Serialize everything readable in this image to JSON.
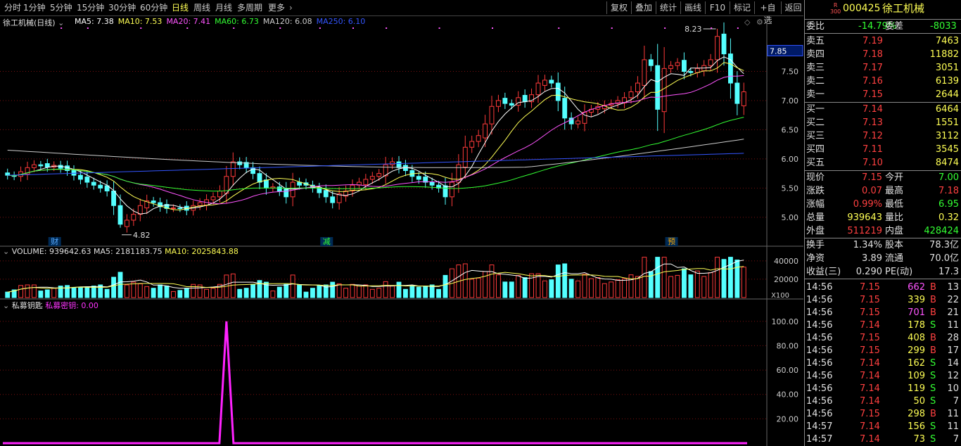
{
  "toolbar": {
    "tabs": [
      "分时",
      "1分钟",
      "5分钟",
      "15分钟",
      "30分钟",
      "60分钟",
      "日线",
      "周线",
      "月线",
      "多周期",
      "更多"
    ],
    "active_tab": "日线",
    "more_arrow": "›",
    "right_buttons": [
      "复权",
      "叠加",
      "统计",
      "画线",
      "F10",
      "标记",
      "+自选",
      "返回"
    ]
  },
  "stock": {
    "code": "000425",
    "name": "徐工机械",
    "badge_top": "R",
    "badge_bottom": "300"
  },
  "kline_header": {
    "title": "徐工机械(日线)",
    "ma": [
      {
        "label": "MA5: 7.38",
        "color": "#ffffff"
      },
      {
        "label": "MA10: 7.53",
        "color": "#ffff55"
      },
      {
        "label": "MA20: 7.41",
        "color": "#ff55ff"
      },
      {
        "label": "MA60: 6.73",
        "color": "#33ff33"
      },
      {
        "label": "MA120: 6.08",
        "color": "#cccccc"
      },
      {
        "label": "MA250: 6.10",
        "color": "#3355ff"
      }
    ],
    "high_label": "8.23",
    "low_label": "4.82",
    "current_price_tag": "7.85",
    "price_ticks": [
      "7.50",
      "7.00",
      "6.50",
      "6.00",
      "5.50",
      "5.00"
    ],
    "markers": [
      "财",
      "减",
      "预"
    ]
  },
  "volume_header": {
    "label": "VOLUME: 939642.63",
    "ma5": "MA5: 2181183.75",
    "ma10": "MA10: 2025843.88",
    "ticks": [
      "40000",
      "20000"
    ],
    "unit": "X100"
  },
  "indicator_header": {
    "name": "私募钥匙",
    "line_label": "私募密钥: 0.00",
    "ticks": [
      "100.00",
      "80.00",
      "60.00",
      "40.00",
      "20.00"
    ]
  },
  "order_book": {
    "weibi_label": "委比",
    "weibi_value": "-14.79%",
    "weicha_label": "委差",
    "weicha_value": "-8033",
    "asks": [
      {
        "label": "卖五",
        "price": "7.19",
        "vol": "7463"
      },
      {
        "label": "卖四",
        "price": "7.18",
        "vol": "11882"
      },
      {
        "label": "卖三",
        "price": "7.17",
        "vol": "3051"
      },
      {
        "label": "卖二",
        "price": "7.16",
        "vol": "6139"
      },
      {
        "label": "卖一",
        "price": "7.15",
        "vol": "2644"
      }
    ],
    "bids": [
      {
        "label": "买一",
        "price": "7.14",
        "vol": "6464"
      },
      {
        "label": "买二",
        "price": "7.13",
        "vol": "1551"
      },
      {
        "label": "买三",
        "price": "7.12",
        "vol": "3112"
      },
      {
        "label": "买四",
        "price": "7.11",
        "vol": "3545"
      },
      {
        "label": "买五",
        "price": "7.10",
        "vol": "8474"
      }
    ]
  },
  "quote": [
    {
      "l1": "现价",
      "v1": "7.15",
      "c1": "red",
      "l2": "今开",
      "v2": "7.00",
      "c2": "green"
    },
    {
      "l1": "涨跌",
      "v1": "0.07",
      "c1": "red",
      "l2": "最高",
      "v2": "7.18",
      "c2": "red"
    },
    {
      "l1": "涨幅",
      "v1": "0.99%",
      "c1": "red",
      "l2": "最低",
      "v2": "6.95",
      "c2": "green"
    },
    {
      "l1": "总量",
      "v1": "939643",
      "c1": "yellow",
      "l2": "量比",
      "v2": "0.32",
      "c2": "yellow"
    },
    {
      "l1": "外盘",
      "v1": "511219",
      "c1": "red",
      "l2": "内盘",
      "v2": "428424",
      "c2": "green"
    }
  ],
  "fundamentals": [
    {
      "l1": "换手",
      "v1": "1.34%",
      "l2": "股本",
      "v2": "78.3亿"
    },
    {
      "l1": "净资",
      "v1": "3.89",
      "l2": "流通",
      "v2": "70.0亿"
    },
    {
      "l1": "收益(三)",
      "v1": "0.290",
      "l2": "PE(动)",
      "v2": "17.3"
    }
  ],
  "ticks": [
    {
      "time": "14:56",
      "price": "7.15",
      "vol": "662",
      "side": "B",
      "n": "13",
      "pc": "red",
      "vc": "magenta"
    },
    {
      "time": "14:56",
      "price": "7.15",
      "vol": "339",
      "side": "B",
      "n": "22",
      "pc": "red",
      "vc": "yellow"
    },
    {
      "time": "14:56",
      "price": "7.15",
      "vol": "701",
      "side": "B",
      "n": "21",
      "pc": "red",
      "vc": "magenta"
    },
    {
      "time": "14:56",
      "price": "7.14",
      "vol": "178",
      "side": "S",
      "n": "11",
      "pc": "red",
      "vc": "yellow"
    },
    {
      "time": "14:56",
      "price": "7.15",
      "vol": "408",
      "side": "B",
      "n": "28",
      "pc": "red",
      "vc": "yellow"
    },
    {
      "time": "14:56",
      "price": "7.15",
      "vol": "299",
      "side": "B",
      "n": "17",
      "pc": "red",
      "vc": "yellow"
    },
    {
      "time": "14:56",
      "price": "7.14",
      "vol": "162",
      "side": "S",
      "n": "14",
      "pc": "red",
      "vc": "yellow"
    },
    {
      "time": "14:56",
      "price": "7.14",
      "vol": "109",
      "side": "S",
      "n": "12",
      "pc": "red",
      "vc": "yellow"
    },
    {
      "time": "14:56",
      "price": "7.14",
      "vol": "119",
      "side": "S",
      "n": "10",
      "pc": "red",
      "vc": "yellow"
    },
    {
      "time": "14:56",
      "price": "7.14",
      "vol": "50",
      "side": "S",
      "n": "7",
      "pc": "red",
      "vc": "yellow"
    },
    {
      "time": "14:56",
      "price": "7.15",
      "vol": "298",
      "side": "B",
      "n": "11",
      "pc": "red",
      "vc": "yellow"
    },
    {
      "time": "14:57",
      "price": "7.14",
      "vol": "156",
      "side": "S",
      "n": "11",
      "pc": "red",
      "vc": "yellow"
    },
    {
      "time": "14:57",
      "price": "7.14",
      "vol": "73",
      "side": "S",
      "n": "7",
      "pc": "red",
      "vc": "yellow"
    }
  ],
  "chart_data": {
    "type": "candlestick",
    "closes": [
      5.72,
      5.7,
      5.78,
      5.85,
      5.9,
      5.88,
      5.86,
      5.89,
      5.84,
      5.8,
      5.72,
      5.65,
      5.6,
      5.55,
      5.5,
      5.45,
      5.2,
      4.88,
      4.95,
      5.05,
      5.2,
      5.28,
      5.25,
      5.18,
      5.15,
      5.16,
      5.15,
      5.12,
      5.2,
      5.25,
      5.3,
      5.35,
      5.45,
      5.7,
      5.95,
      5.9,
      5.85,
      5.75,
      5.6,
      5.5,
      5.52,
      5.45,
      5.35,
      5.6,
      5.55,
      5.55,
      5.5,
      5.42,
      5.35,
      5.25,
      5.4,
      5.45,
      5.55,
      5.6,
      5.65,
      5.7,
      5.75,
      5.9,
      5.95,
      5.85,
      5.8,
      5.7,
      5.65,
      5.6,
      5.55,
      5.5,
      5.35,
      5.6,
      5.9,
      6.2,
      6.3,
      6.4,
      6.6,
      6.9,
      7.0,
      6.95,
      6.92,
      7.05,
      6.98,
      7.1,
      7.3,
      7.35,
      7.3,
      7.0,
      6.7,
      6.6,
      6.65,
      6.8,
      6.85,
      6.9,
      6.92,
      6.95,
      7.0,
      7.05,
      7.15,
      7.3,
      7.7,
      7.6,
      6.85,
      7.55,
      7.6,
      7.65,
      7.5,
      7.48,
      7.55,
      7.6,
      7.7,
      8.1,
      7.8,
      7.3,
      6.95,
      7.15
    ],
    "ma_series": [
      "MA5",
      "MA10",
      "MA20",
      "MA60",
      "MA120",
      "MA250"
    ],
    "volume_ylim": [
      0,
      40000
    ],
    "indicator_ylim": [
      0,
      100
    ],
    "indicator_spike": 100
  }
}
